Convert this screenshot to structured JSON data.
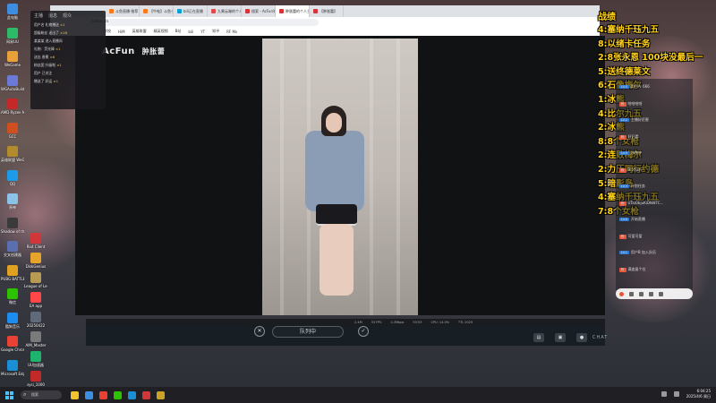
{
  "desktop": {
    "icons": [
      {
        "label": "此电脑",
        "color": "#3d8de0"
      },
      {
        "label": "网易UU",
        "color": "#2dbb6a"
      },
      {
        "label": "WeGame",
        "color": "#e8a038"
      },
      {
        "label": "WGAutoBuild",
        "color": "#6b7ad6"
      },
      {
        "label": "AMD Ryzen Master",
        "color": "#c52828"
      },
      {
        "label": "GCC",
        "color": "#d04f20"
      },
      {
        "label": "英雄联盟 WeGame版",
        "color": "#b28c2c"
      },
      {
        "label": "QQ",
        "color": "#1c9ce8"
      },
      {
        "label": "原神",
        "color": "#8ac2e8"
      },
      {
        "label": "Shadow of the Tomb",
        "color": "#3a3a3a"
      },
      {
        "label": "交叉创建器",
        "color": "#5a6fb0"
      },
      {
        "label": "PUBG BATTLEGROUNDS",
        "color": "#e0a020"
      },
      {
        "label": "微信",
        "color": "#2dc100"
      },
      {
        "label": "酷狗音乐",
        "color": "#1d8cf0"
      },
      {
        "label": "Google Chrome",
        "color": "#e94235"
      },
      {
        "label": "Microsoft Edge",
        "color": "#1a8fd6"
      },
      {
        "label": "Riot Client",
        "color": "#d13639"
      },
      {
        "label": "DiskGenius",
        "color": "#e6a42a"
      },
      {
        "label": "League of Legends",
        "color": "#b89a52"
      },
      {
        "label": "EA app",
        "color": "#ff4747"
      },
      {
        "label": "20250422",
        "color": "#5f6b7a"
      },
      {
        "label": "AIM_Master",
        "color": "#7a7a7a"
      },
      {
        "label": "UU加速器",
        "color": "#1db56d"
      },
      {
        "label": "sysi_1000",
        "color": "#c22a2a"
      }
    ]
  },
  "browser": {
    "tabs": [
      {
        "title": "斗鱼直播·推荐",
        "color": "#ff7a17"
      },
      {
        "title": "【牛蛙】斗鱼·奶茶",
        "color": "#ff7a17"
      },
      {
        "title": "bili正在直播",
        "color": "#00a1d6"
      },
      {
        "title": "九霄云端的个人...",
        "color": "#e34b4b"
      },
      {
        "title": "搜索 - AcFun弹幕",
        "color": "#d3353a"
      },
      {
        "title": "肿胀蕾的个人主页",
        "color": "#d3353a"
      },
      {
        "title": "【肿胀蕾】",
        "color": "#d3353a"
      }
    ],
    "address": "acfun.cn",
    "bookmarks": [
      "学校",
      "HiM",
      "英雄联盟",
      "精英视频",
      "B站",
      "bili",
      "YT",
      "知乎",
      "RF Mv"
    ]
  },
  "player": {
    "channel_logo": "AcFun",
    "channel_name": "肿胀蕾",
    "stats": [
      "2.4M",
      "33 FPS",
      "0.3Mbps",
      "93:53",
      "CPU: 14.0%",
      "TTL 2025"
    ],
    "queue_label": "队列中",
    "close_label": "✕",
    "accept_label": "✓"
  },
  "mini_chat": {
    "tabs": [
      "主播",
      "消息",
      "观众"
    ],
    "lines": [
      {
        "text": "用户名 礼物赠送",
        "hl": "×1"
      },
      {
        "text": "超级粉丝 送出了",
        "hl": "×18"
      },
      {
        "text": "某某某 进入直播间",
        "hl": ""
      },
      {
        "text": "礼物：荧光棒",
        "hl": "×1"
      },
      {
        "text": "送出 香蕉",
        "hl": "×6"
      },
      {
        "text": "粉丝团 升级啦",
        "hl": "×1"
      },
      {
        "text": "用户 已关注",
        "hl": ""
      },
      {
        "text": "赠送了 好运",
        "hl": "×1"
      }
    ]
  },
  "overlay": {
    "title": "战绩",
    "items": [
      "4:塞纳千珏九五",
      "8:以绪卡任务",
      "2:8张永恩 100块没最后一",
      "5:送终德莱文",
      "6:石像梅尔",
      "1:冰熊",
      "4:比尔九五",
      "2:冰熊",
      "8:8个女枪",
      "2:连败梅尔",
      "2:力压同行约德",
      "5:暗影岛",
      "4:塞纳千珏九五",
      "7:8个女枪"
    ]
  },
  "chat_panel": {
    "rows": [
      {
        "badge": "LV.5",
        "text": "用户A: 666"
      },
      {
        "badge": "粉",
        "text": "哈哈哈哈"
      },
      {
        "badge": "LV.2",
        "text": "主播好厉害"
      },
      {
        "badge": "粉",
        "text": "好好看"
      },
      {
        "badge": "LV.9",
        "text": "冲冲冲"
      },
      {
        "badge": "粉",
        "text": "9:57pm"
      },
      {
        "badge": "LV.3",
        "text": "计划任务"
      },
      {
        "badge": "粉",
        "text": "UTaiObjuKiDNi8TC..."
      },
      {
        "badge": "LV.6",
        "text": "开始直播"
      },
      {
        "badge": "粉",
        "text": "可爱可爱"
      },
      {
        "badge": "LV.1",
        "text": "用户B 加入队伍"
      },
      {
        "badge": "粉",
        "text": "满血复个位"
      }
    ],
    "input_hint": "发送弹幕"
  },
  "game_ui": {
    "logo": "CHAT"
  },
  "taskbar": {
    "search": "搜索",
    "apps": [
      "#f2c12e",
      "#3d8de0",
      "#e94235",
      "#2dc100",
      "#1a8fd6",
      "#d13639",
      "#c9a227"
    ],
    "time": "6:04:25",
    "date": "2025/4/6 周日"
  }
}
